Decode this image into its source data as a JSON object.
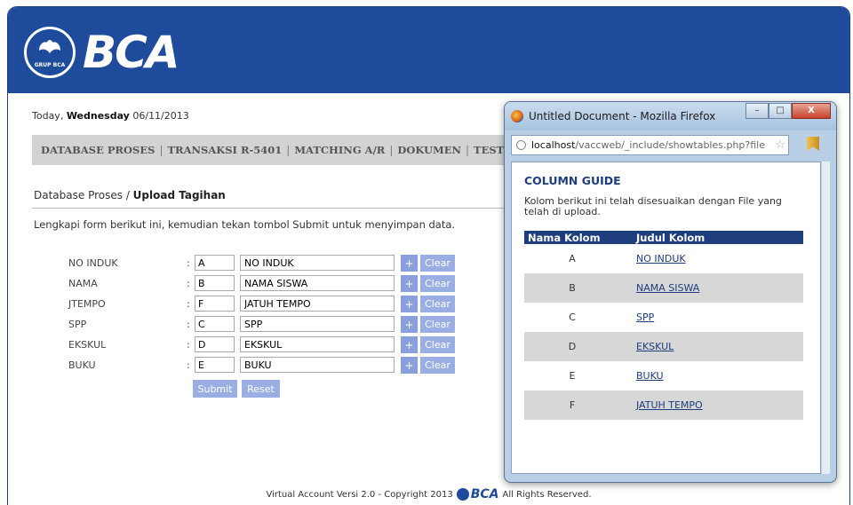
{
  "brand": {
    "logo_text": "BCA",
    "logo_subtext": "GRUP BCA"
  },
  "date": {
    "prefix": "Today, ",
    "day": "Wednesday",
    "date": "06/11/2013"
  },
  "menu": {
    "items": [
      "DATABASE PROSES",
      "TRANSAKSI R-5401",
      "MATCHING A/R",
      "DOKUMEN",
      "TEST FILE"
    ],
    "separator": "|"
  },
  "breadcrumb": {
    "parent": "Database Proses",
    "separator": " / ",
    "current": "Upload Tagihan"
  },
  "instruction": "Lengkapi form berikut ini, kemudian tekan tombol Submit untuk menyimpan data.",
  "form": {
    "colon": ":",
    "rows": [
      {
        "label": "NO INDUK",
        "column": "A",
        "title": "NO INDUK"
      },
      {
        "label": "NAMA",
        "column": "B",
        "title": "NAMA SISWA"
      },
      {
        "label": "JTEMPO",
        "column": "F",
        "title": "JATUH TEMPO"
      },
      {
        "label": "SPP",
        "column": "C",
        "title": "SPP"
      },
      {
        "label": "EKSKUL",
        "column": "D",
        "title": "EKSKUL"
      },
      {
        "label": "BUKU",
        "column": "E",
        "title": "BUKU"
      }
    ],
    "plus_label": "+",
    "clear_label": "Clear",
    "submit_label": "Submit",
    "reset_label": "Reset"
  },
  "footer": {
    "left_text": "Virtual Account Versi 2.0 - Copyright 2013",
    "logo_text": "BCA",
    "right_text": "All Rights Reserved."
  },
  "popup": {
    "window_title": "Untitled Document - Mozilla Firefox",
    "url_host": "localhost",
    "url_rest": "/vaccweb/_include/showtables.php?file",
    "heading": "COLUMN GUIDE",
    "description": "Kolom berikut ini telah disesuaikan dengan File yang telah di upload.",
    "table_headers": [
      "Nama Kolom",
      "Judul Kolom"
    ],
    "table_rows": [
      {
        "kolom": "A",
        "judul": "NO INDUK"
      },
      {
        "kolom": "B",
        "judul": "NAMA SISWA"
      },
      {
        "kolom": "C",
        "judul": "SPP"
      },
      {
        "kolom": "D",
        "judul": "EKSKUL"
      },
      {
        "kolom": "E",
        "judul": "BUKU"
      },
      {
        "kolom": "F",
        "judul": "JATUH TEMPO"
      }
    ],
    "window_buttons": {
      "minimize": "–",
      "maximize": "□",
      "close": "X"
    },
    "star": "☆"
  },
  "colors": {
    "brand_blue": "#1e4b9c",
    "button_blue": "#9aaee4",
    "table_header": "#1d3d7c"
  },
  "icons": [
    "bca-logo-icon",
    "firefox-icon",
    "globe-icon",
    "star-icon",
    "bookmark-icon"
  ]
}
